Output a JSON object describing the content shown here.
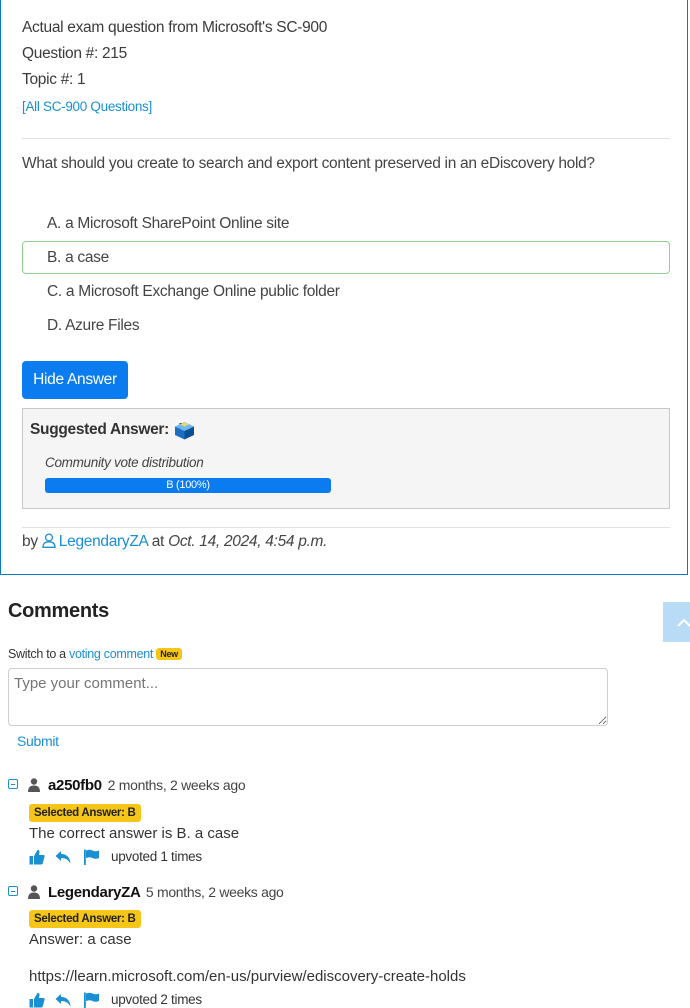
{
  "question": {
    "source_line": "Actual exam question from Microsoft's SC-900",
    "number_line": "Question #: 215",
    "topic_line": "Topic #: 1",
    "all_link": "[All SC-900 Questions]",
    "text": "What should you create to search and export content preserved in an eDiscovery hold?",
    "choices": [
      {
        "letter": "A.",
        "text": "a Microsoft SharePoint Online site"
      },
      {
        "letter": "B.",
        "text": "a case"
      },
      {
        "letter": "C.",
        "text": "a Microsoft Exchange Online public folder"
      },
      {
        "letter": "D.",
        "text": "Azure Files"
      }
    ]
  },
  "answer": {
    "hide_button": "Hide Answer",
    "suggested_label": "Suggested Answer:",
    "suggested_value": "B",
    "vote_label": "Community vote distribution",
    "vote_bar_text": "B (100%)",
    "vote_fraction": 1.0
  },
  "byline": {
    "by": "by",
    "user": "LegendaryZA",
    "at": "at",
    "date": "Oct. 14, 2024, 4:54 p.m."
  },
  "comments_section": {
    "title": "Comments",
    "switch_text": "Switch to a",
    "switch_link": "voting comment",
    "new_badge": "New",
    "input_placeholder": "Type your comment...",
    "submit": "Submit"
  },
  "comments": [
    {
      "user": "a250fb0",
      "time": "2 months, 2 weeks ago",
      "selected": "Selected Answer: B",
      "lines": [
        "The correct answer is B. a case"
      ],
      "upvotes": "upvoted 1 times"
    },
    {
      "user": "LegendaryZA",
      "time": "5 months, 2 weeks ago",
      "selected": "Selected Answer: B",
      "lines": [
        "Answer: a case",
        "https://learn.microsoft.com/en-us/purview/ediscovery-create-holds"
      ],
      "upvotes": "upvoted 2 times"
    }
  ],
  "colors": {
    "accent": "#0b7bf0",
    "link": "#1a8fd1",
    "badge": "#f5c518",
    "correct_border": "#8fd18f"
  }
}
